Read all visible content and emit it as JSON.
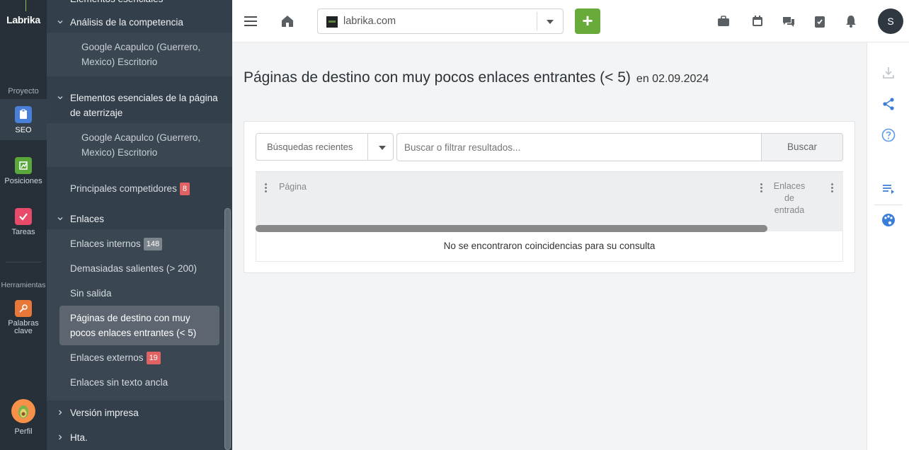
{
  "rail": {
    "logo": "Labrika",
    "section_project": "Proyecto",
    "section_tools": "Herramientas",
    "items": [
      {
        "label": "SEO",
        "icon": "clipboard-icon",
        "color": "#4a7fd9",
        "active": true
      },
      {
        "label": "Posiciones",
        "icon": "chart-icon",
        "color": "#5aa83c",
        "active": false
      },
      {
        "label": "Tareas",
        "icon": "check-icon",
        "color": "#e84a6a",
        "active": false
      },
      {
        "label": "Palabras clave",
        "icon": "key-icon",
        "color": "#e8773a",
        "active": false
      }
    ],
    "profile_label": "Perfil"
  },
  "sidebar": {
    "cut_top": "Elementos esenciales",
    "items": {
      "competition": "Análisis de la competencia",
      "competition_sub": "Google Acapulco (Guerrero, Mexico) Escritorio",
      "landing": "Elementos esenciales de la página de aterrizaje",
      "landing_sub": "Google Acapulco (Guerrero, Mexico) Escritorio",
      "main_competitors": "Principales competidores",
      "main_competitors_badge": "8",
      "links": "Enlaces",
      "internal_links": "Enlaces internos",
      "internal_links_badge": "148",
      "too_many_out": "Demasiadas salientes (> 200)",
      "no_exit": "Sin salida",
      "few_incoming": "Páginas de destino con muy pocos enlaces entrantes (< 5)",
      "external_links": "Enlaces externos",
      "external_links_badge": "19",
      "no_anchor": "Enlaces sin texto ancla",
      "print_version": "Versión impresa",
      "hta": "Hta."
    }
  },
  "topbar": {
    "site": "labrika.com",
    "add_label": "+",
    "user_initial": "S"
  },
  "main": {
    "title": "Páginas de destino con muy pocos enlaces entrantes (< 5)",
    "date": "en 02.09.2024",
    "recent_searches": "Búsquedas recientes",
    "search_placeholder": "Buscar o filtrar resultados...",
    "search_button": "Buscar",
    "columns": [
      "Página",
      "Enlaces de entrada"
    ],
    "empty_message": "No se encontraron coincidencias para su consulta"
  }
}
